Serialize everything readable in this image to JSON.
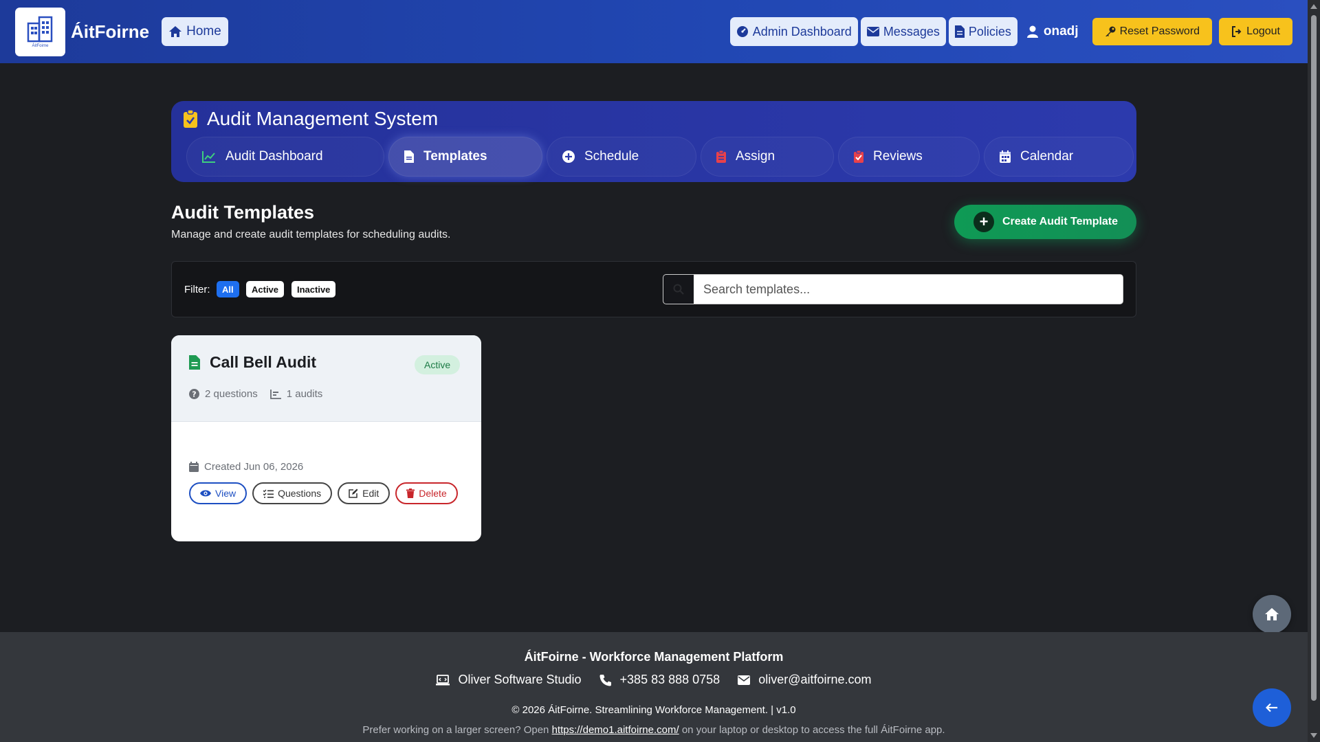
{
  "navbar": {
    "brand": "ÁitFoirne",
    "brand_small": "ÁitFoirne",
    "home": "Home",
    "admin_dashboard": "Admin Dashboard",
    "messages": "Messages",
    "policies": "Policies",
    "user": "onadj",
    "reset_password": "Reset Password",
    "logout": "Logout"
  },
  "audit_header": {
    "title": "Audit Management System",
    "tabs": [
      {
        "label": "Audit Dashboard",
        "icon": "chart-line-icon",
        "active": false
      },
      {
        "label": "Templates",
        "icon": "file-icon",
        "active": true
      },
      {
        "label": "Schedule",
        "icon": "plus-circle-icon",
        "active": false
      },
      {
        "label": "Assign",
        "icon": "clipboard-icon",
        "active": false
      },
      {
        "label": "Reviews",
        "icon": "clipboard-check-icon",
        "active": false
      },
      {
        "label": "Calendar",
        "icon": "calendar-icon",
        "active": false
      }
    ]
  },
  "section": {
    "title": "Audit Templates",
    "subtitle": "Manage and create audit templates for scheduling audits.",
    "create_button": "Create Audit Template"
  },
  "filter": {
    "label": "Filter:",
    "options": [
      "All",
      "Active",
      "Inactive"
    ],
    "selected": "All",
    "search_placeholder": "Search templates..."
  },
  "templates": [
    {
      "title": "Call Bell Audit",
      "status": "Active",
      "questions": "2 questions",
      "audits": "1 audits",
      "created": "Created Jun 06, 2026",
      "actions": {
        "view": "View",
        "questions": "Questions",
        "edit": "Edit",
        "delete": "Delete"
      }
    }
  ],
  "footer": {
    "title": "ÁitFoirne - Workforce Management Platform",
    "company": "Oliver Software Studio",
    "phone": "+385 83 888 0758",
    "email": "oliver@aitfoirne.com",
    "copyright": "© 2026 ÁitFoirne. Streamlining Workforce Management. | v1.0",
    "note_prefix": "Prefer working on a larger screen? Open",
    "note_link": "https://demo1.aitfoirne.com/",
    "note_suffix": "on your laptop or desktop to access the full ÁitFoirne app."
  },
  "colors": {
    "navbar": "#2147b3",
    "panel": "#2c3aad",
    "create": "#0f9a55",
    "primary": "#1e6ff0",
    "warning": "#f7c21c",
    "danger": "#c8262b"
  }
}
